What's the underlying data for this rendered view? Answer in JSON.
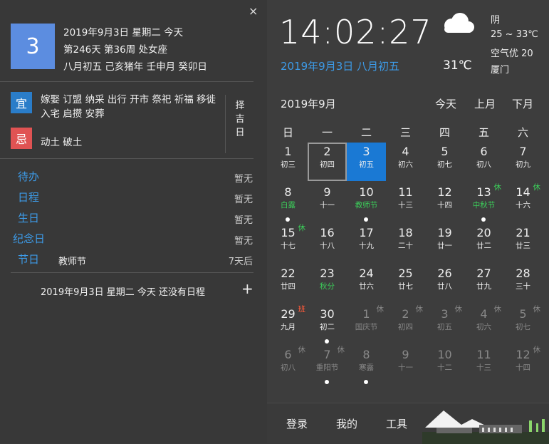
{
  "left": {
    "close_icon": "×",
    "big_day": "3",
    "info_lines": [
      "2019年9月3日 星期二 今天",
      "第246天 第36周 处女座",
      "八月初五 己亥猪年 壬申月 癸卯日"
    ],
    "yi_label": "宜",
    "yi_items": [
      "嫁娶 订盟 纳采 出行 开市 祭祀 祈福 移徙",
      "入宅 启攒 安葬"
    ],
    "ji_label": "忌",
    "ji_items": "动土 破土",
    "zeji": [
      "择",
      "吉",
      "日"
    ],
    "categories": [
      {
        "label": "待办",
        "value": "暂无",
        "note": ""
      },
      {
        "label": "日程",
        "value": "暂无",
        "note": ""
      },
      {
        "label": "生日",
        "value": "暂无",
        "note": ""
      },
      {
        "label": "纪念日",
        "value": "暂无",
        "note": ""
      },
      {
        "label": "节日",
        "value": "7天后",
        "note": "教师节"
      }
    ],
    "schedule_text": "2019年9月3日 星期二 今天 还没有日程",
    "add_icon": "+"
  },
  "clock": {
    "time": "14:02:27",
    "date": "2019年9月3日 八月初五",
    "temperature": "31℃"
  },
  "weather": {
    "icon": "cloud-icon",
    "condition": "阴",
    "range": "25 ~ 33℃",
    "air": "空气优 20",
    "city": "厦门"
  },
  "calendar": {
    "month_label": "2019年9月",
    "today_btn": "今天",
    "prev_btn": "上月",
    "next_btn": "下月",
    "weekdays": [
      "日",
      "一",
      "二",
      "三",
      "四",
      "五",
      "六"
    ],
    "weeks": [
      [
        {
          "d": "1",
          "s": "初三",
          "m": "cur"
        },
        {
          "d": "2",
          "s": "初四",
          "m": "cur",
          "sel": true
        },
        {
          "d": "3",
          "s": "初五",
          "m": "cur",
          "today": true
        },
        {
          "d": "4",
          "s": "初六",
          "m": "cur"
        },
        {
          "d": "5",
          "s": "初七",
          "m": "cur"
        },
        {
          "d": "6",
          "s": "初八",
          "m": "cur"
        },
        {
          "d": "7",
          "s": "初九",
          "m": "cur"
        }
      ],
      [
        {
          "d": "8",
          "s": "白露",
          "m": "cur",
          "green": true,
          "dot": true
        },
        {
          "d": "9",
          "s": "十一",
          "m": "cur"
        },
        {
          "d": "10",
          "s": "教师节",
          "m": "cur",
          "green": true,
          "dot": true
        },
        {
          "d": "11",
          "s": "十三",
          "m": "cur"
        },
        {
          "d": "12",
          "s": "十四",
          "m": "cur"
        },
        {
          "d": "13",
          "s": "中秋节",
          "m": "cur",
          "green": true,
          "badge": "休",
          "bt": "hol",
          "dot": true
        },
        {
          "d": "14",
          "s": "十六",
          "m": "cur",
          "badge": "休",
          "bt": "hol"
        }
      ],
      [
        {
          "d": "15",
          "s": "十七",
          "m": "cur",
          "badge": "休",
          "bt": "hol"
        },
        {
          "d": "16",
          "s": "十八",
          "m": "cur"
        },
        {
          "d": "17",
          "s": "十九",
          "m": "cur"
        },
        {
          "d": "18",
          "s": "二十",
          "m": "cur"
        },
        {
          "d": "19",
          "s": "廿一",
          "m": "cur"
        },
        {
          "d": "20",
          "s": "廿二",
          "m": "cur"
        },
        {
          "d": "21",
          "s": "廿三",
          "m": "cur"
        }
      ],
      [
        {
          "d": "22",
          "s": "廿四",
          "m": "cur"
        },
        {
          "d": "23",
          "s": "秋分",
          "m": "cur",
          "green": true
        },
        {
          "d": "24",
          "s": "廿六",
          "m": "cur"
        },
        {
          "d": "25",
          "s": "廿七",
          "m": "cur"
        },
        {
          "d": "26",
          "s": "廿八",
          "m": "cur"
        },
        {
          "d": "27",
          "s": "廿九",
          "m": "cur"
        },
        {
          "d": "28",
          "s": "三十",
          "m": "cur"
        }
      ],
      [
        {
          "d": "29",
          "s": "九月",
          "m": "cur",
          "badge": "班",
          "bt": "work"
        },
        {
          "d": "30",
          "s": "初二",
          "m": "cur",
          "dot": true
        },
        {
          "d": "1",
          "s": "国庆节",
          "m": "oth",
          "badge": "休",
          "bt": "oth"
        },
        {
          "d": "2",
          "s": "初四",
          "m": "oth",
          "badge": "休",
          "bt": "oth"
        },
        {
          "d": "3",
          "s": "初五",
          "m": "oth",
          "badge": "休",
          "bt": "oth"
        },
        {
          "d": "4",
          "s": "初六",
          "m": "oth",
          "badge": "休",
          "bt": "oth"
        },
        {
          "d": "5",
          "s": "初七",
          "m": "oth",
          "badge": "休",
          "bt": "oth"
        }
      ],
      [
        {
          "d": "6",
          "s": "初八",
          "m": "oth",
          "badge": "休",
          "bt": "oth"
        },
        {
          "d": "7",
          "s": "重阳节",
          "m": "oth",
          "badge": "休",
          "bt": "oth",
          "dot": true
        },
        {
          "d": "8",
          "s": "寒露",
          "m": "oth",
          "dot": true
        },
        {
          "d": "9",
          "s": "十一",
          "m": "oth"
        },
        {
          "d": "10",
          "s": "十二",
          "m": "oth"
        },
        {
          "d": "11",
          "s": "十三",
          "m": "oth"
        },
        {
          "d": "12",
          "s": "十四",
          "m": "oth",
          "badge": "休",
          "bt": "oth"
        }
      ]
    ]
  },
  "bottom": {
    "login": "登录",
    "mine": "我的",
    "tools": "工具"
  },
  "colors": {
    "accent": "#3d9be8",
    "today": "#1a79d4",
    "yi": "#2a7dc9",
    "ji": "#e05353",
    "holiday": "#3ccf5a",
    "work": "#ff5a3a"
  }
}
